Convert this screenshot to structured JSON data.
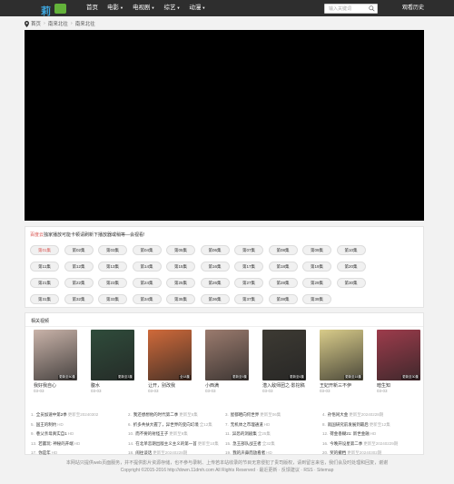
{
  "header": {
    "logo_text": "莉",
    "nav": [
      {
        "label": "首页",
        "has_caret": false
      },
      {
        "label": "电影",
        "has_caret": true
      },
      {
        "label": "电视剧",
        "has_caret": true
      },
      {
        "label": "综艺",
        "has_caret": true
      },
      {
        "label": "动漫",
        "has_caret": true
      }
    ],
    "search_placeholder": "输入关键词",
    "history_label": "观看历史"
  },
  "breadcrumb": [
    "首页",
    "南来北往",
    "南来北往"
  ],
  "episodes": {
    "notice_prefix": "百度云",
    "notice_text": "独家播放可能卡顿请刷新下播放器或稍等—会视看!",
    "list": [
      "第01集",
      "第02集",
      "第03集",
      "第04集",
      "第05集",
      "第06集",
      "第07集",
      "第08集",
      "第09集",
      "第10集",
      "第11集",
      "第12集",
      "第13集",
      "第14集",
      "第15集",
      "第16集",
      "第17集",
      "第18集",
      "第19集",
      "第20集",
      "第21集",
      "第22集",
      "第23集",
      "第24集",
      "第25集",
      "第26集",
      "第27集",
      "第28集",
      "第29集",
      "第30集",
      "第31集",
      "第32集",
      "第33集",
      "第34集",
      "第35集",
      "第36集",
      "第37集",
      "第38集",
      "第39集"
    ],
    "active_index": 0
  },
  "related": {
    "title": "相关视频",
    "cards": [
      {
        "title": "我好我自心",
        "date": "03-03",
        "badge": "更新至50集",
        "color": "#c9b3a9"
      },
      {
        "title": "腹水",
        "date": "03-03",
        "badge": "更新至3集",
        "color": "#2f4c3b"
      },
      {
        "title": "让开，别改我",
        "date": "03-03",
        "badge": "全18集",
        "color": "#d06a3a"
      },
      {
        "title": "小西满",
        "date": "03-03",
        "badge": "更新至9集",
        "color": "#9b7b6e"
      },
      {
        "title": "潜入敌师团之·影挖稿",
        "date": "03-03",
        "badge": "更新至6集",
        "color": "#3d3a33"
      },
      {
        "title": "王妃开新三不伊",
        "date": "03-03",
        "badge": "更新至15集",
        "color": "#d9cc8a"
      },
      {
        "title": "暗生知",
        "date": "03-03",
        "badge": "更新至30集",
        "color": "#9e3c4c"
      }
    ],
    "toplist": [
      {
        "n": "1.",
        "t": "全员加速中第2季",
        "u": "更新至20240302"
      },
      {
        "n": "2.",
        "t": "我还想想他的时代第二季",
        "u": "更新至5集"
      },
      {
        "n": "3.",
        "t": "屋都晒向何世界",
        "u": "更新至06集"
      },
      {
        "n": "4.",
        "t": "孙悟闲大金",
        "u": "更新至20240228期"
      },
      {
        "n": "5.",
        "t": "国王的制约",
        "u": "HD"
      },
      {
        "n": "6.",
        "t": "折多共扶大握了，异世界的变向幻境",
        "u": "全12集"
      },
      {
        "n": "7.",
        "t": "无机体之市理通道",
        "u": "HD"
      },
      {
        "n": "8.",
        "t": "就国研究前发展到最后",
        "u": "更新至12集"
      },
      {
        "n": "9.",
        "t": "巷父亲母真实自1",
        "u": "HD"
      },
      {
        "n": "10.",
        "t": "而不要的射怪王子",
        "u": "更新至9集"
      },
      {
        "n": "11.",
        "t": "异恐的洞剧集",
        "u": "全25集"
      },
      {
        "n": "12.",
        "t": "荷金香糊21: 新世金融",
        "u": "HD"
      },
      {
        "n": "13.",
        "t": "若嬴玩: 神秘的开端",
        "u": "HD"
      },
      {
        "n": "14.",
        "t": "在北单恋期出版主义主义的第一首",
        "u": "更新至10集"
      },
      {
        "n": "15.",
        "t": "急王部队战王者",
        "u": "全32集"
      },
      {
        "n": "16.",
        "t": "今晚开设星第二季",
        "u": "更新至20240229期"
      },
      {
        "n": "17.",
        "t": "你是年",
        "u": "HD"
      },
      {
        "n": "18.",
        "t": "闹往谈话",
        "u": "更新至20240228期"
      },
      {
        "n": "19.",
        "t": "我的声鼻而放看者",
        "u": "HD"
      },
      {
        "n": "20.",
        "t": "奖的撤档",
        "u": "更新至20240302期"
      }
    ]
  },
  "footer": {
    "line1": "本网站只提供web页面服务，并不提供影片资源存储，也不参与录制、上传若本站收录的节目无意侵犯了贵司版权，请到留言来信，我们会及时处理和回复，谢谢",
    "line2": "Copyright ©2015-2016 http://down.11dmh.com All Rights Reserved · 最近更新 · 反馈建议 · RSS · Sitemap"
  }
}
